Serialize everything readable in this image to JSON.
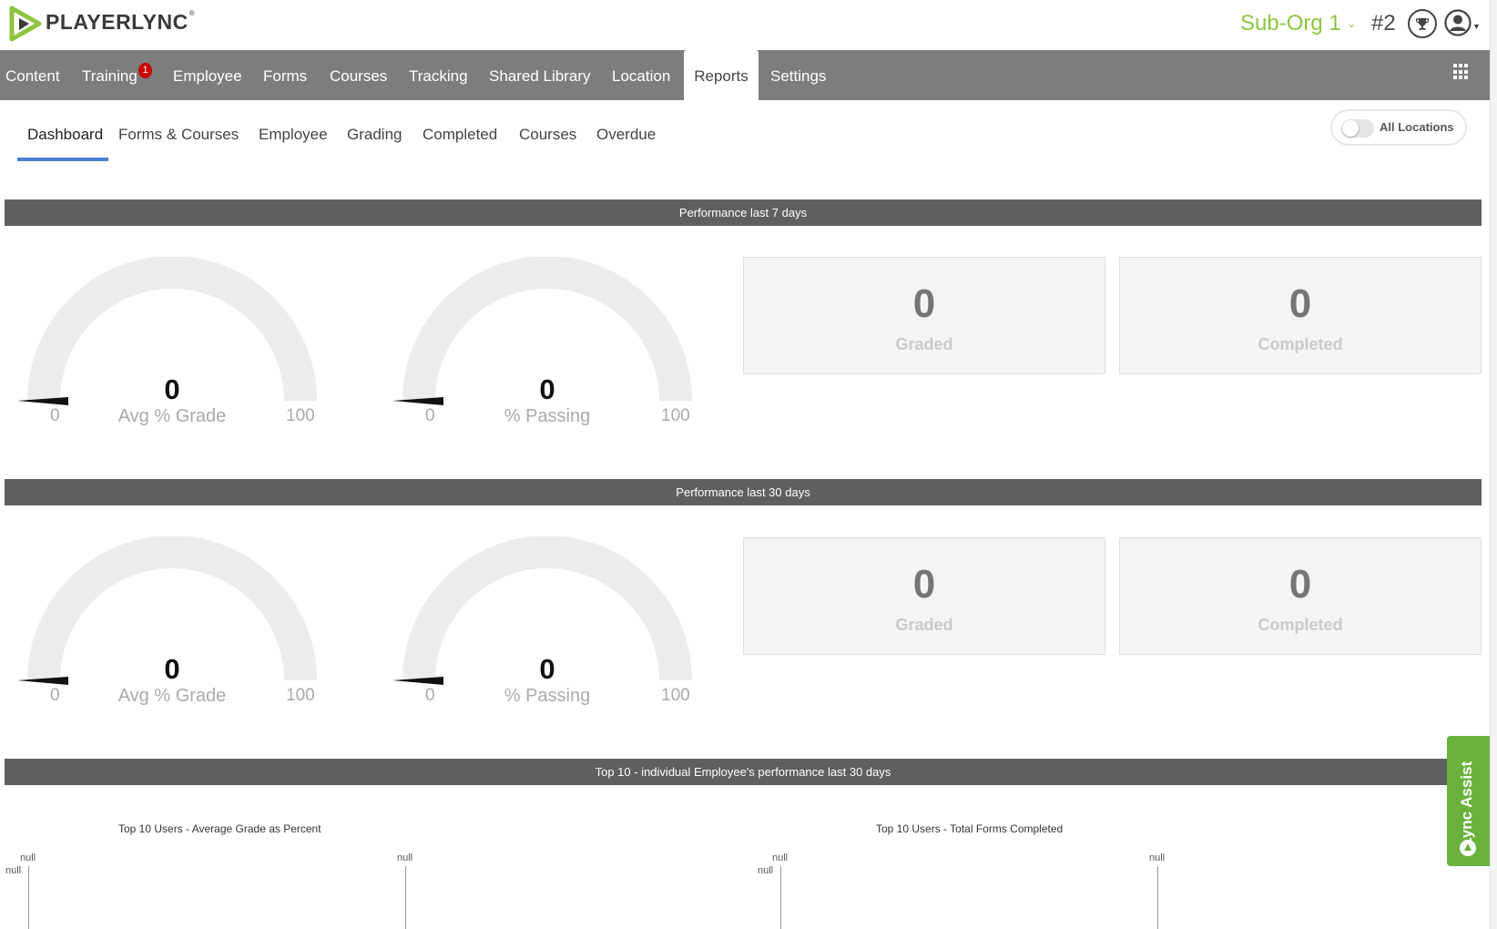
{
  "header": {
    "logo_text": "PLAYERLYNC",
    "logo_reg": "®",
    "org_name": "Sub-Org 1",
    "rank": "#2",
    "trophy_icon": "trophy-icon",
    "avatar_icon": "user-avatar-icon",
    "colors": {
      "brand_green": "#8cc63f"
    }
  },
  "main_nav": {
    "items": [
      {
        "label": "Content"
      },
      {
        "label": "Training",
        "badge": "1"
      },
      {
        "label": "Employee"
      },
      {
        "label": "Forms"
      },
      {
        "label": "Courses"
      },
      {
        "label": "Tracking"
      },
      {
        "label": "Shared Library"
      },
      {
        "label": "Location"
      },
      {
        "label": "Reports",
        "active": true
      },
      {
        "label": "Settings"
      }
    ],
    "apps_icon": "grid-icon"
  },
  "sub_tabs": {
    "items": [
      {
        "label": "Dashboard",
        "active": true
      },
      {
        "label": "Forms & Courses"
      },
      {
        "label": "Employee"
      },
      {
        "label": "Grading"
      },
      {
        "label": "Completed"
      },
      {
        "label": "Courses"
      },
      {
        "label": "Overdue"
      }
    ],
    "toggle_label": "All Locations",
    "toggle_on": false
  },
  "perf7": {
    "title": "Performance last 7 days",
    "gauge_grade": {
      "value": "0",
      "label": "Avg % Grade",
      "min": "0",
      "max": "100"
    },
    "gauge_passing": {
      "value": "0",
      "label": "% Passing",
      "min": "0",
      "max": "100"
    },
    "graded": {
      "value": "0",
      "label": "Graded"
    },
    "completed": {
      "value": "0",
      "label": "Completed"
    }
  },
  "perf30": {
    "title": "Performance last 30 days",
    "gauge_grade": {
      "value": "0",
      "label": "Avg % Grade",
      "min": "0",
      "max": "100"
    },
    "gauge_passing": {
      "value": "0",
      "label": "% Passing",
      "min": "0",
      "max": "100"
    },
    "graded": {
      "value": "0",
      "label": "Graded"
    },
    "completed": {
      "value": "0",
      "label": "Completed"
    }
  },
  "top10": {
    "title": "Top 10 - individual Employee's performance last 30 days",
    "chart_avg_title": "Top 10 Users - Average Grade as Percent",
    "chart_forms_title": "Top 10 Users - Total Forms Completed",
    "null_text": "null"
  },
  "assist": {
    "label": "Lync Assist",
    "icon": "assist-icon"
  }
}
